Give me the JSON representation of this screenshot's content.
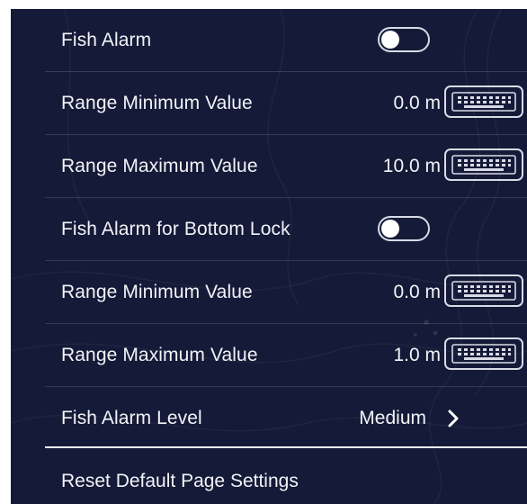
{
  "settings": {
    "fish_alarm": {
      "label": "Fish Alarm",
      "enabled": false
    },
    "range_min_1": {
      "label": "Range Minimum Value",
      "value": "0.0 m"
    },
    "range_max_1": {
      "label": "Range Maximum Value",
      "value": "10.0 m"
    },
    "fish_alarm_bottom_lock": {
      "label": "Fish Alarm for Bottom Lock",
      "enabled": false
    },
    "range_min_2": {
      "label": "Range Minimum Value",
      "value": "0.0 m"
    },
    "range_max_2": {
      "label": "Range Maximum Value",
      "value": "1.0 m"
    },
    "fish_alarm_level": {
      "label": "Fish Alarm Level",
      "value": "Medium"
    }
  },
  "reset": {
    "label": "Reset Default Page Settings"
  },
  "icons": {
    "keyboard": "keyboard-icon",
    "toggle": "toggle-switch",
    "chevron": "chevron-right-icon"
  },
  "colors": {
    "background": "#141a37",
    "text": "#f2f3f7",
    "outline": "#d8dbe6"
  }
}
